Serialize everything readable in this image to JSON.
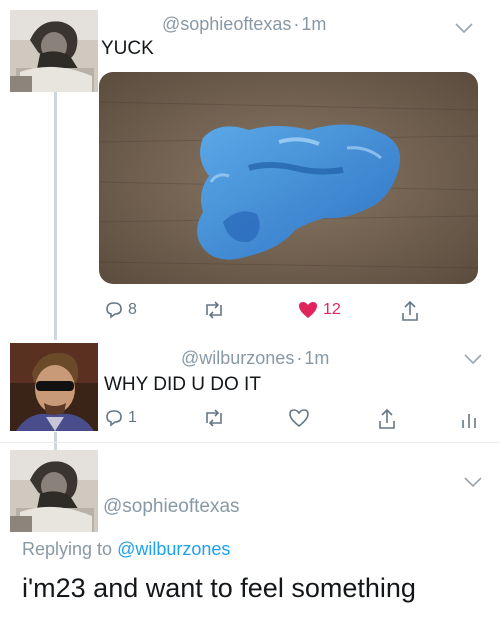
{
  "tweets": [
    {
      "handle": "@sophieoftexas",
      "time": "1m",
      "text": "YUCK",
      "media": {
        "description": "blue-slime-photo"
      },
      "actions": {
        "replies": "8",
        "retweets": "",
        "likes": "12",
        "liked": true
      }
    },
    {
      "handle": "@wilburzones",
      "time": "1m",
      "text": "WHY DID U DO IT",
      "actions": {
        "replies": "1",
        "retweets": "",
        "likes": "",
        "liked": false
      }
    },
    {
      "handle": "@sophieoftexas",
      "replying_prefix": "Replying to",
      "replying_to": "@wilburzones",
      "text": "i'm23 and want to feel something"
    }
  ],
  "colors": {
    "handle": "#8899a6",
    "icon": "#657786",
    "like": "#e0245e",
    "link": "#1da1f2",
    "thread_line": "#ccd6dd"
  },
  "separator": "·"
}
